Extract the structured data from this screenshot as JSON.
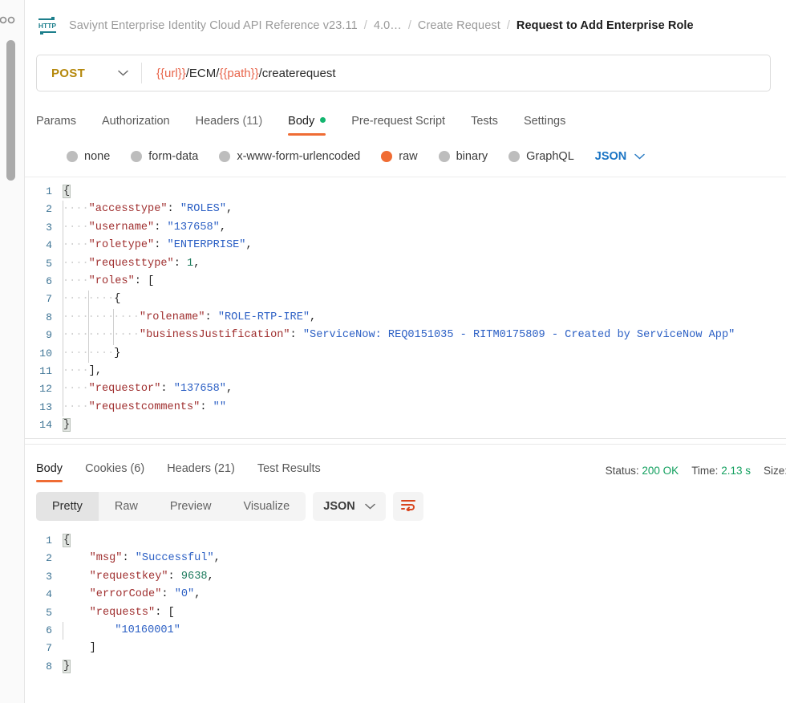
{
  "app": "Postman",
  "left_rail": {
    "scrollbar_name": "vertical-scrollbar"
  },
  "breadcrumb": {
    "icon": "http-protocol-icon",
    "separator": "/",
    "items": [
      {
        "label": "Saviynt Enterprise Identity Cloud API Reference v23.11",
        "current": false
      },
      {
        "label": "4.0…",
        "current": false
      },
      {
        "label": "Create Request",
        "current": false
      },
      {
        "label": "Request to Add Enterprise Role",
        "current": true
      }
    ]
  },
  "url_bar": {
    "method": "POST",
    "method_caret": "chevron-down-icon",
    "url_parts": [
      {
        "text": "{{url}}",
        "variable": true
      },
      {
        "text": "/ECM/",
        "variable": false
      },
      {
        "text": "{{path}}",
        "variable": true
      },
      {
        "text": "/createrequest",
        "variable": false
      }
    ],
    "url_full": "{{url}}/ECM/{{path}}/createrequest"
  },
  "request_tabs": [
    {
      "label": "Params",
      "count": "",
      "active": false,
      "dot": false
    },
    {
      "label": "Authorization",
      "count": "",
      "active": false,
      "dot": false
    },
    {
      "label": "Headers",
      "count": "(11)",
      "active": false,
      "dot": false
    },
    {
      "label": "Body",
      "count": "",
      "active": true,
      "dot": true
    },
    {
      "label": "Pre-request Script",
      "count": "",
      "active": false,
      "dot": false
    },
    {
      "label": "Tests",
      "count": "",
      "active": false,
      "dot": false
    },
    {
      "label": "Settings",
      "count": "",
      "active": false,
      "dot": false
    }
  ],
  "body_types": {
    "options": [
      {
        "label": "none",
        "selected": false
      },
      {
        "label": "form-data",
        "selected": false
      },
      {
        "label": "x-www-form-urlencoded",
        "selected": false
      },
      {
        "label": "raw",
        "selected": true
      },
      {
        "label": "binary",
        "selected": false
      },
      {
        "label": "GraphQL",
        "selected": false
      }
    ],
    "format": "JSON",
    "format_caret": "chevron-down-icon"
  },
  "request_body": {
    "language": "json",
    "line_count": 14,
    "text": "{\n    \"accesstype\": \"ROLES\",\n    \"username\": \"137658\",\n    \"roletype\": \"ENTERPRISE\",\n    \"requesttype\": 1,\n    \"roles\": [\n        {\n            \"rolename\": \"ROLE-RTP-IRE\",\n            \"businessJustification\": \"ServiceNow: REQ0151035 - RITM0175809 - Created by ServiceNow App\"\n        }\n    ],\n    \"requestor\": \"137658\",\n    \"requestcomments\": \"\"\n}",
    "lines": [
      {
        "no": 1,
        "indent": 0,
        "tokens": [
          {
            "t": "{",
            "c": "brk"
          }
        ]
      },
      {
        "no": 2,
        "indent": 1,
        "tokens": [
          {
            "t": "\"accesstype\"",
            "c": "k"
          },
          {
            "t": ": ",
            "c": "p"
          },
          {
            "t": "\"ROLES\"",
            "c": "s"
          },
          {
            "t": ",",
            "c": "p"
          }
        ]
      },
      {
        "no": 3,
        "indent": 1,
        "tokens": [
          {
            "t": "\"username\"",
            "c": "k"
          },
          {
            "t": ": ",
            "c": "p"
          },
          {
            "t": "\"137658\"",
            "c": "s"
          },
          {
            "t": ",",
            "c": "p"
          }
        ]
      },
      {
        "no": 4,
        "indent": 1,
        "tokens": [
          {
            "t": "\"roletype\"",
            "c": "k"
          },
          {
            "t": ": ",
            "c": "p"
          },
          {
            "t": "\"ENTERPRISE\"",
            "c": "s"
          },
          {
            "t": ",",
            "c": "p"
          }
        ]
      },
      {
        "no": 5,
        "indent": 1,
        "tokens": [
          {
            "t": "\"requesttype\"",
            "c": "k"
          },
          {
            "t": ": ",
            "c": "p"
          },
          {
            "t": "1",
            "c": "n"
          },
          {
            "t": ",",
            "c": "p"
          }
        ]
      },
      {
        "no": 6,
        "indent": 1,
        "tokens": [
          {
            "t": "\"roles\"",
            "c": "k"
          },
          {
            "t": ": ",
            "c": "p"
          },
          {
            "t": "[",
            "c": "p"
          }
        ]
      },
      {
        "no": 7,
        "indent": 2,
        "tokens": [
          {
            "t": "{",
            "c": "p"
          }
        ]
      },
      {
        "no": 8,
        "indent": 3,
        "tokens": [
          {
            "t": "\"rolename\"",
            "c": "k"
          },
          {
            "t": ": ",
            "c": "p"
          },
          {
            "t": "\"ROLE-RTP-IRE\"",
            "c": "s"
          },
          {
            "t": ",",
            "c": "p"
          }
        ]
      },
      {
        "no": 9,
        "indent": 3,
        "tokens": [
          {
            "t": "\"businessJustification\"",
            "c": "k"
          },
          {
            "t": ": ",
            "c": "p"
          },
          {
            "t": "\"ServiceNow: REQ0151035 - RITM0175809 - Created by ServiceNow App\"",
            "c": "s"
          }
        ]
      },
      {
        "no": 10,
        "indent": 2,
        "tokens": [
          {
            "t": "}",
            "c": "p"
          }
        ]
      },
      {
        "no": 11,
        "indent": 1,
        "tokens": [
          {
            "t": "]",
            "c": "p"
          },
          {
            "t": ",",
            "c": "p"
          }
        ]
      },
      {
        "no": 12,
        "indent": 1,
        "tokens": [
          {
            "t": "\"requestor\"",
            "c": "k"
          },
          {
            "t": ": ",
            "c": "p"
          },
          {
            "t": "\"137658\"",
            "c": "s"
          },
          {
            "t": ",",
            "c": "p"
          }
        ]
      },
      {
        "no": 13,
        "indent": 1,
        "tokens": [
          {
            "t": "\"requestcomments\"",
            "c": "k"
          },
          {
            "t": ": ",
            "c": "p"
          },
          {
            "t": "\"\"",
            "c": "s"
          }
        ]
      },
      {
        "no": 14,
        "indent": 0,
        "tokens": [
          {
            "t": "}",
            "c": "brk"
          }
        ]
      }
    ]
  },
  "response_tabs": [
    {
      "label": "Body",
      "active": true
    },
    {
      "label": "Cookies (6)",
      "active": false
    },
    {
      "label": "Headers (21)",
      "active": false
    },
    {
      "label": "Test Results",
      "active": false
    }
  ],
  "response_meta": {
    "status_label": "Status:",
    "status_value": "200 OK",
    "time_label": "Time:",
    "time_value": "2.13 s",
    "size_label": "Size:"
  },
  "response_toolbar": {
    "views": [
      {
        "label": "Pretty",
        "active": true
      },
      {
        "label": "Raw",
        "active": false
      },
      {
        "label": "Preview",
        "active": false
      },
      {
        "label": "Visualize",
        "active": false
      }
    ],
    "format": "JSON",
    "format_caret": "chevron-down-icon",
    "wrap_icon": "word-wrap-icon"
  },
  "response_body": {
    "language": "json",
    "line_count": 8,
    "text": "{\n    \"msg\": \"Successful\",\n    \"requestkey\": 9638,\n    \"errorCode\": \"0\",\n    \"requests\": [\n        \"10160001\"\n    ]\n}",
    "lines": [
      {
        "no": 1,
        "indent": 0,
        "tokens": [
          {
            "t": "{",
            "c": "brk"
          }
        ]
      },
      {
        "no": 2,
        "indent": 1,
        "tokens": [
          {
            "t": "\"msg\"",
            "c": "k"
          },
          {
            "t": ": ",
            "c": "p"
          },
          {
            "t": "\"Successful\"",
            "c": "s"
          },
          {
            "t": ",",
            "c": "p"
          }
        ]
      },
      {
        "no": 3,
        "indent": 1,
        "tokens": [
          {
            "t": "\"requestkey\"",
            "c": "k"
          },
          {
            "t": ": ",
            "c": "p"
          },
          {
            "t": "9638",
            "c": "n"
          },
          {
            "t": ",",
            "c": "p"
          }
        ]
      },
      {
        "no": 4,
        "indent": 1,
        "tokens": [
          {
            "t": "\"errorCode\"",
            "c": "k"
          },
          {
            "t": ": ",
            "c": "p"
          },
          {
            "t": "\"0\"",
            "c": "s"
          },
          {
            "t": ",",
            "c": "p"
          }
        ]
      },
      {
        "no": 5,
        "indent": 1,
        "tokens": [
          {
            "t": "\"requests\"",
            "c": "k"
          },
          {
            "t": ": ",
            "c": "p"
          },
          {
            "t": "[",
            "c": "p"
          }
        ]
      },
      {
        "no": 6,
        "indent": 2,
        "tokens": [
          {
            "t": "\"10160001\"",
            "c": "s"
          }
        ]
      },
      {
        "no": 7,
        "indent": 1,
        "tokens": [
          {
            "t": "]",
            "c": "p"
          }
        ]
      },
      {
        "no": 8,
        "indent": 0,
        "tokens": [
          {
            "t": "}",
            "c": "brk"
          }
        ]
      }
    ]
  },
  "colors": {
    "accent_orange": "#ef6c34",
    "method_post": "#b5880c",
    "variable_red": "#e8654b",
    "status_green": "#13a05f",
    "link_blue": "#1a74c4",
    "json_key": "#a03030",
    "json_string": "#2b5fc4",
    "json_number": "#1c7a5c"
  }
}
